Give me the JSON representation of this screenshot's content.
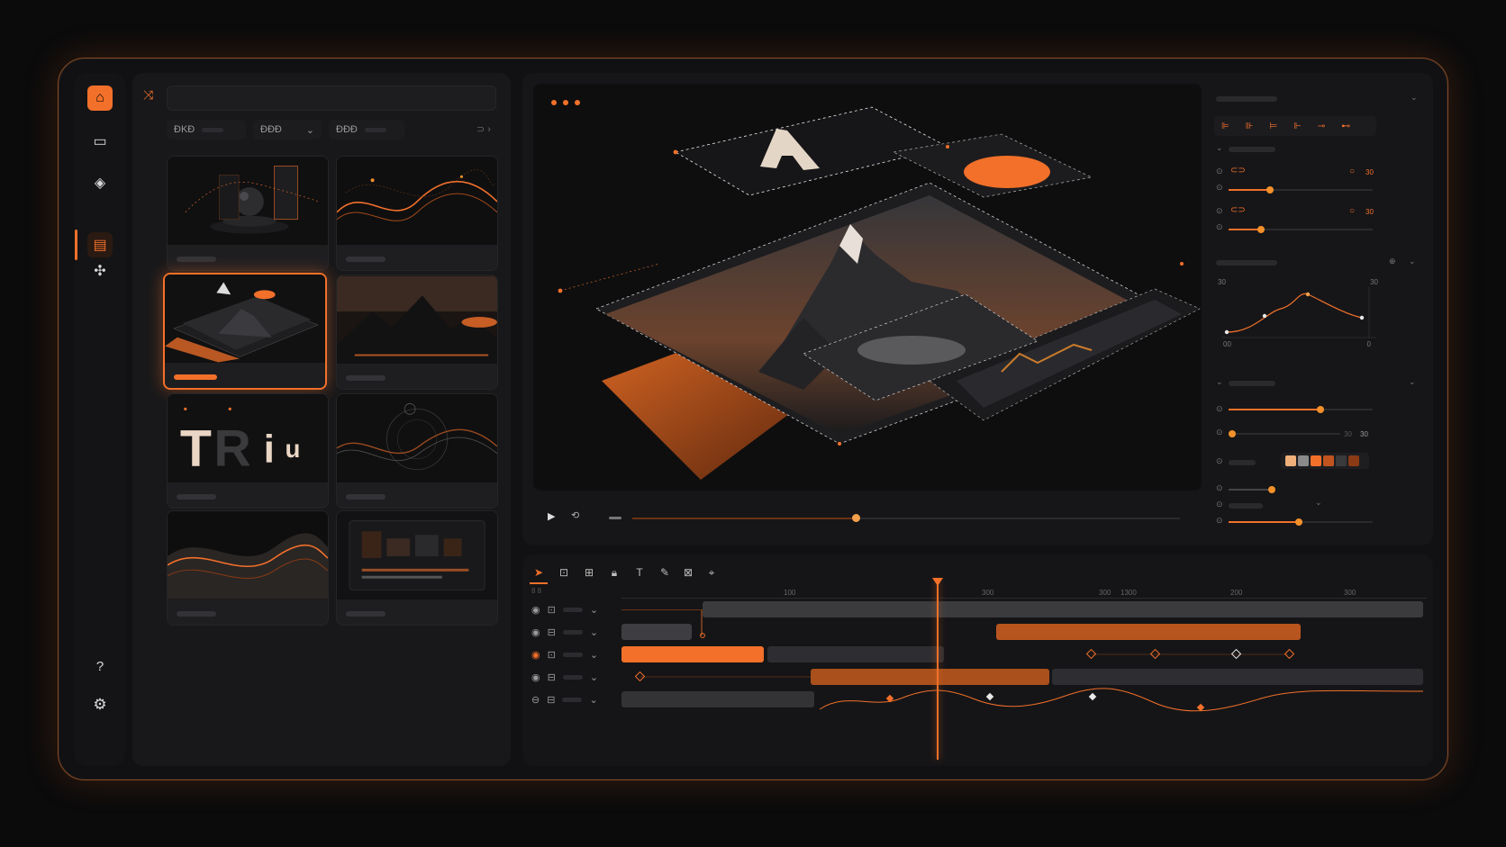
{
  "colors": {
    "accent": "#f2702a",
    "background": "#111113",
    "panel": "#18181a"
  },
  "rail": {
    "items": [
      {
        "name": "home-icon",
        "glyph": "⌂"
      },
      {
        "name": "folder-icon",
        "glyph": "▭"
      },
      {
        "name": "layers-icon",
        "glyph": "◈"
      },
      {
        "name": "library-icon",
        "glyph": "▤"
      },
      {
        "name": "puzzle-icon",
        "glyph": "✣"
      }
    ],
    "help_glyph": "?",
    "settings_glyph": "⚙"
  },
  "assets": {
    "search_placeholder": "",
    "filters": [
      {
        "label": "ÐKÐ",
        "chevron": ""
      },
      {
        "label": "ÐÐÐ",
        "chevron": "⌄"
      },
      {
        "label": "ÐÐÐ",
        "chevron": ""
      }
    ],
    "filter_more": "⊃ ›",
    "tiles": [
      "sphere-scene",
      "orange-waves",
      "layered-mountain",
      "mountain-sunset",
      "typography-tru",
      "wave-circles",
      "dunes-glow",
      "editor-ui"
    ]
  },
  "transport": {
    "play": "▶",
    "loop": "⟲"
  },
  "properties": {
    "values": [
      "30",
      "30"
    ],
    "graph_labels": {
      "top_left": "30",
      "top_right": "30",
      "bottom_left": "00",
      "bottom_right": "0"
    },
    "slider_value": "30",
    "slider_value_sub": "30",
    "swatches": [
      "#f0b07a",
      "#8a8a8a",
      "#f2702a",
      "#c0541e",
      "#3a3a3d",
      "#8a3a14"
    ]
  },
  "timeline": {
    "tools": [
      "cursor-icon",
      "crop-icon",
      "group-icon",
      "lock-icon",
      "text-icon",
      "pen-icon",
      "frame-icon",
      "transform-icon"
    ],
    "tool_glyphs": [
      "➤",
      "⊡",
      "⊞",
      "🔒︎",
      "T",
      "✎",
      "⊠",
      "⌖"
    ],
    "ruler": [
      "100",
      "300",
      "300",
      "1300",
      "200",
      "300"
    ],
    "track_label": "8 8"
  }
}
